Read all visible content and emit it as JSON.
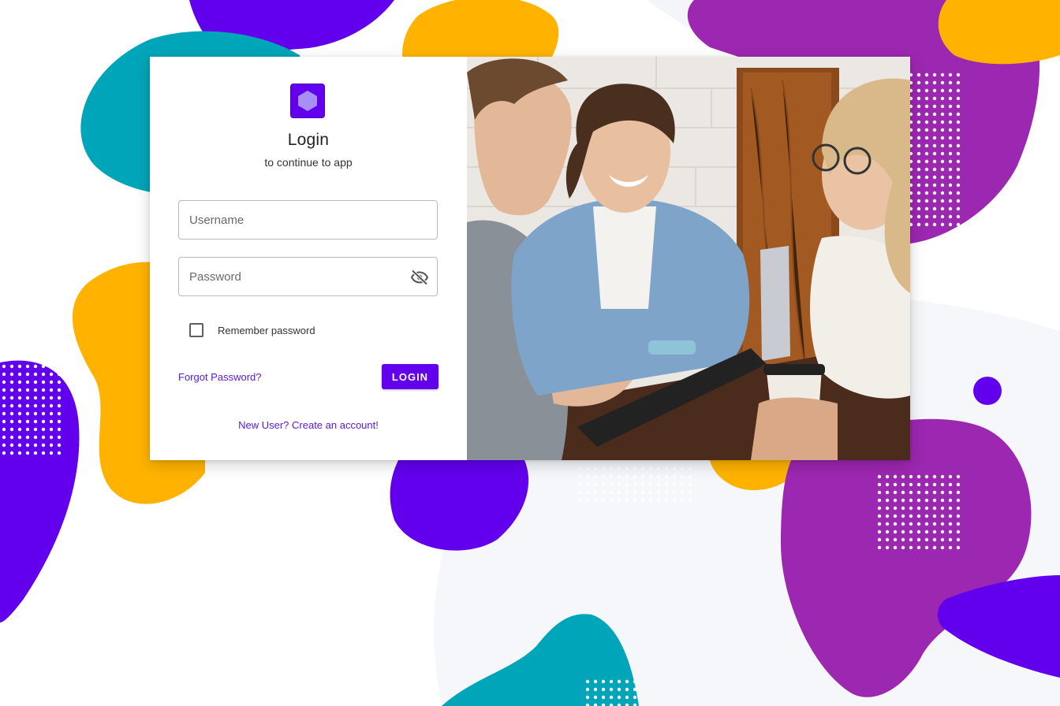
{
  "form": {
    "title": "Login",
    "subtitle": "to continue to app",
    "username_placeholder": "Username",
    "password_placeholder": "Password",
    "remember_label": "Remember password",
    "forgot_link": "Forgot Password?",
    "login_button": "LOGIN",
    "signup_link": "New User? Create an account!"
  },
  "icons": {
    "logo": "hexagon-logo-icon",
    "password_toggle": "eye-off-icon"
  },
  "colors": {
    "primary": "#6200ee",
    "link": "#5b18d8",
    "blob_purple": "#9c27b0",
    "blob_indigo": "#6200ee",
    "blob_teal": "#00a5b9",
    "blob_amber": "#ffb300"
  }
}
